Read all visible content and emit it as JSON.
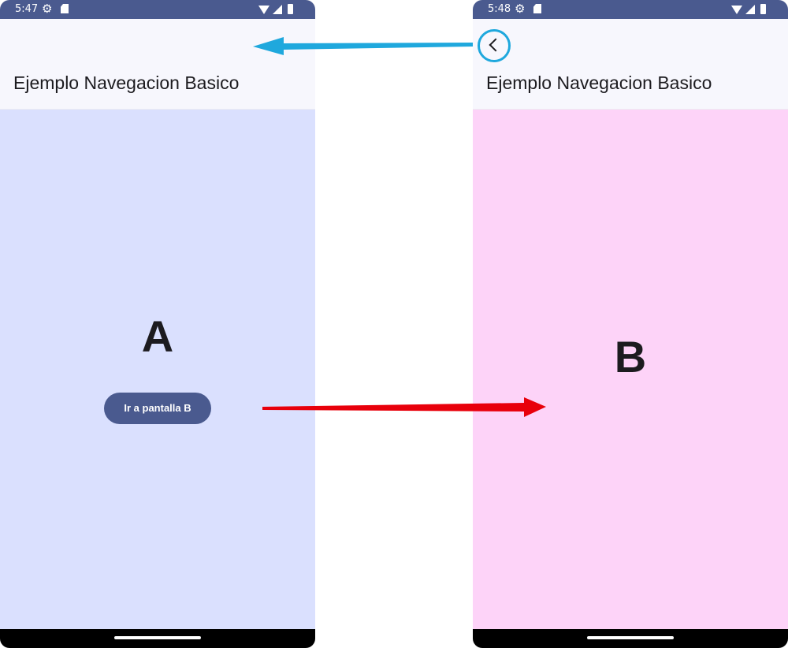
{
  "screen_a": {
    "status": {
      "time": "5:47"
    },
    "app_bar": {
      "title": "Ejemplo Navegacion Basico"
    },
    "content": {
      "letter": "A",
      "button_label": "Ir a pantalla B",
      "background": "#dae0fe"
    }
  },
  "screen_b": {
    "status": {
      "time": "5:48"
    },
    "app_bar": {
      "title": "Ejemplo Navegacion Basico",
      "back_icon": "chevron-left-icon"
    },
    "content": {
      "letter": "B",
      "background": "#fdd3f8"
    }
  },
  "colors": {
    "status_bar": "#4a5a8f",
    "button": "#4a5a8f",
    "forward_arrow": "#e8000b",
    "back_arrow": "#1fa8dd"
  }
}
